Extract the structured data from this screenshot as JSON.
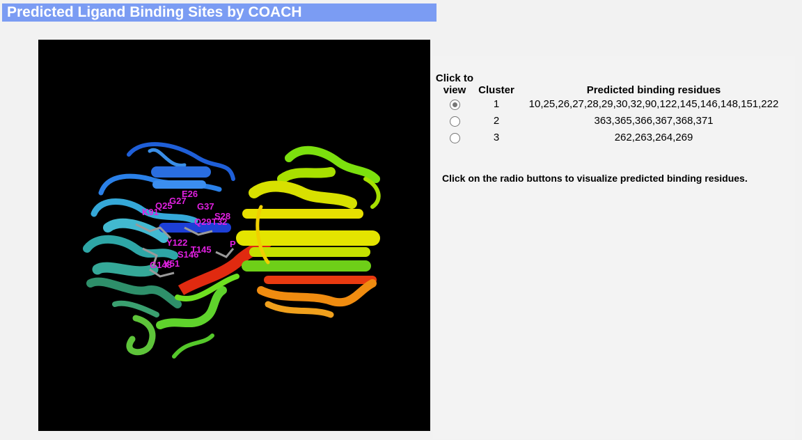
{
  "title": "Predicted Ligand Binding Sites by COACH",
  "viewer": {
    "residue_labels": [
      "E26",
      "G27",
      "Q25",
      "K91",
      "G37",
      "S28",
      "Q29",
      "T32",
      "P",
      "Y122",
      "T145",
      "S146",
      "G148",
      "Y51"
    ]
  },
  "table": {
    "headers": {
      "view": "Click to view",
      "cluster": "Cluster",
      "residues": "Predicted binding residues"
    },
    "rows": [
      {
        "cluster": "1",
        "residues": "10,25,26,27,28,29,30,32,90,122,145,146,148,151,222",
        "selected": true
      },
      {
        "cluster": "2",
        "residues": "363,365,366,367,368,371",
        "selected": false
      },
      {
        "cluster": "3",
        "residues": "262,263,264,269",
        "selected": false
      }
    ]
  },
  "note": "Click on the radio buttons to visualize predicted binding residues.",
  "colors": {
    "title_bar": "#7b9cf3",
    "viewer_bg": "#000000",
    "label_magenta": "#e020e0"
  }
}
